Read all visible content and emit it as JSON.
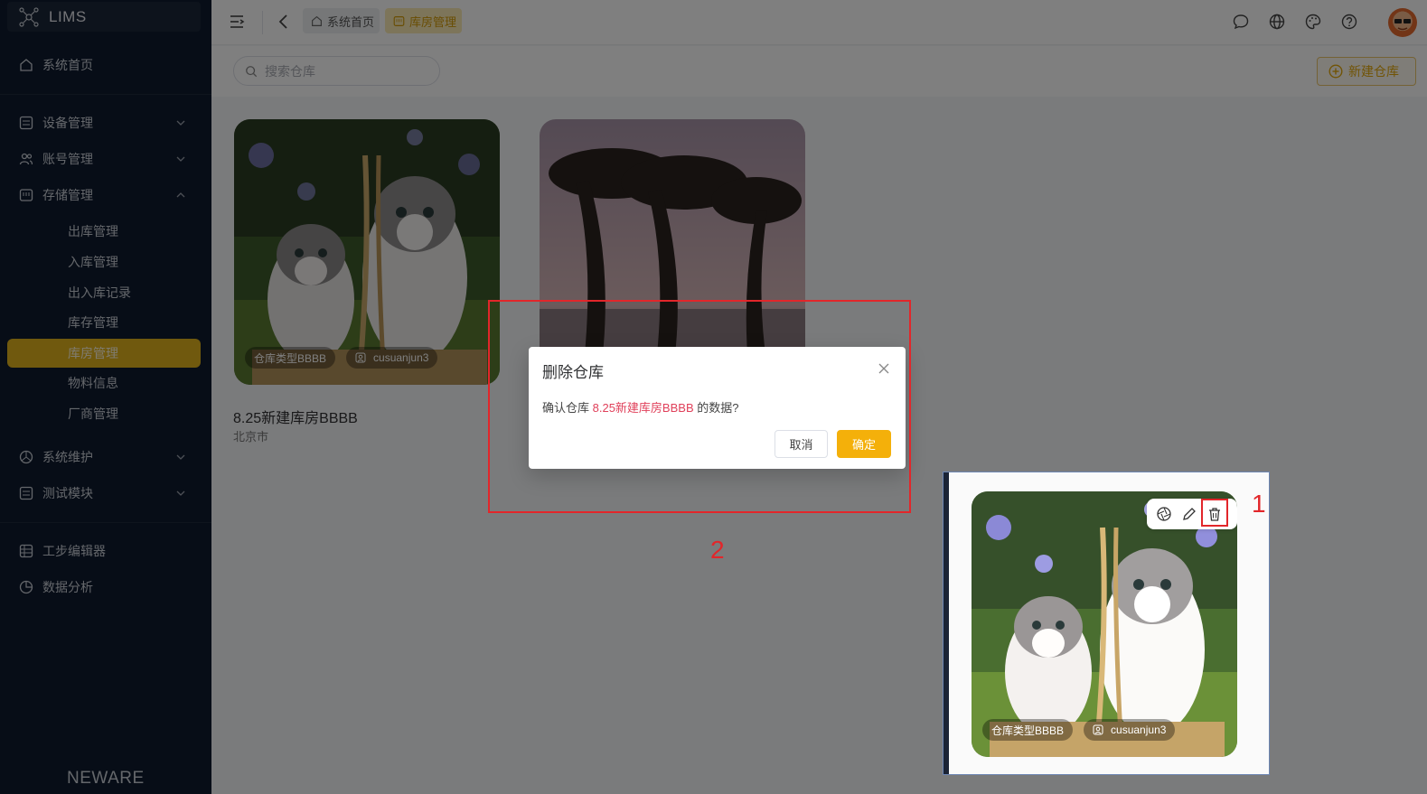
{
  "app": {
    "name": "LIMS",
    "brand_footer": "NEWARE"
  },
  "sidebar": {
    "home": "系统首页",
    "groups": [
      {
        "label": "设备管理"
      },
      {
        "label": "账号管理"
      },
      {
        "label": "存储管理"
      }
    ],
    "storage_children": [
      "出库管理",
      "入库管理",
      "出入库记录",
      "库存管理",
      "库房管理",
      "物料信息",
      "厂商管理"
    ],
    "active_item": "库房管理",
    "groups2": [
      {
        "label": "系统维护"
      },
      {
        "label": "测试模块"
      }
    ],
    "extra": [
      {
        "label": "工步编辑器"
      },
      {
        "label": "数据分析"
      }
    ]
  },
  "header": {
    "breadcrumbs": [
      {
        "label": "系统首页"
      },
      {
        "label": "库房管理"
      }
    ]
  },
  "toolbar": {
    "search_placeholder": "搜索仓库",
    "new_button": "新建仓库"
  },
  "cards": [
    {
      "title": "8.25新建库房BBBB",
      "location": "北京市",
      "type_tag": "仓库类型BBBB",
      "user_tag": "cusuanjun3"
    }
  ],
  "dialog": {
    "title": "删除仓库",
    "message_prefix": "确认仓库 ",
    "message_highlight": "8.25新建库房BBBB",
    "message_suffix": " 的数据?",
    "cancel": "取消",
    "confirm": "确定"
  },
  "annotations": {
    "label_1": "1",
    "label_2": "2"
  },
  "inset": {
    "type_tag": "仓库类型BBBB",
    "user_tag": "cusuanjun3"
  },
  "colors": {
    "accent": "#f4b00a",
    "sidebar_bg": "#0f1a2e",
    "highlight": "#e0405a",
    "annotation": "#e2262a"
  }
}
